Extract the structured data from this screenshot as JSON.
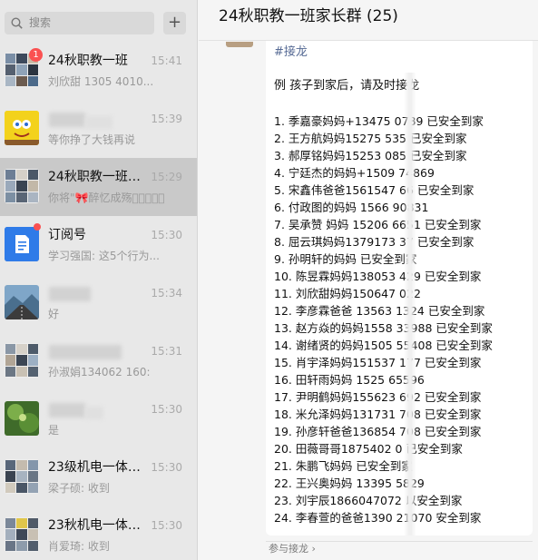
{
  "search": {
    "placeholder": "搜索"
  },
  "add_button": {
    "glyph": "+"
  },
  "conversations": [
    {
      "name": "24秋职教一班",
      "time": "15:41",
      "preview": "刘欣甜 1305 4010...",
      "badge": "1"
    },
    {
      "name": "",
      "time": "15:39",
      "preview": "等你挣了大钱再说"
    },
    {
      "name": "24秋职教一班家...",
      "time": "15:29",
      "preview": "你将\"🎀醉忆成殇\u0000\u0000\u0000\u0000\u0000"
    },
    {
      "name": "订阅号",
      "time": "15:30",
      "preview": "学习强国: 这5个行为..."
    },
    {
      "name": "",
      "time": "15:34",
      "preview": "好"
    },
    {
      "name": "",
      "time": "15:31",
      "preview": "孙淑娟134062 160:"
    },
    {
      "name": "",
      "time": "15:30",
      "preview": "是"
    },
    {
      "name": "23级机电一体化...",
      "time": "15:30",
      "preview": "梁子硕: 收到"
    },
    {
      "name": "23秋机电一体化...",
      "time": "15:30",
      "preview": "肖爱琦: 收到"
    }
  ],
  "chat": {
    "title": "24秋职教一班家长群 (25)",
    "tag": "#接龙",
    "example": "例 孩子到家后，请及时接龙",
    "entries": [
      "1. 季嘉豪妈妈+13475 0789 已安全到家",
      "2. 王方航妈妈15275 535 已安全到家",
      "3. 郝厚铭妈妈15253 085 已安全到家",
      "4. 宁廷杰的妈妈+1509 74869",
      "5. 宋鑫伟爸爸1561547 66 已安全到家",
      "6. 付政图的妈妈  1566 90831",
      "7. 吴承赞  妈妈  15206 6651 已安全到家",
      "8. 屈云琪妈妈1379173 37 已安全到家",
      "9. 孙明轩的妈妈 已安全到家",
      "10. 陈昱霖妈妈138053 429 已安全到家",
      "11. 刘欣甜妈妈150647 022",
      "12. 李彦霖爸爸 13563 1324 已安全到家",
      "13. 赵方焱的妈妈1558 33988 已安全到家",
      "14. 谢绪贤的妈妈1505 55408 已安全到家",
      "15. 肖宇泽妈妈151537 177 已安全到家",
      "16. 田轩雨妈妈    1525 65596",
      "17. 尹明鹤妈妈155623 692 已安全到家",
      "18. 米允泽妈妈131731 708 已安全到家",
      "19. 孙彦轩爸爸136854 708 已安全到家",
      "20. 田薇哥哥1875402 0 已安全到家",
      "21. 朱鹏飞妈妈 已安全到家",
      "22. 王兴奥妈妈  13395 5829",
      "23. 刘宇辰1866047072 以安全到家",
      "24. 李春萱的爸爸1390 21070 安全到家"
    ],
    "solitaire_link": "参与接龙 ›"
  }
}
